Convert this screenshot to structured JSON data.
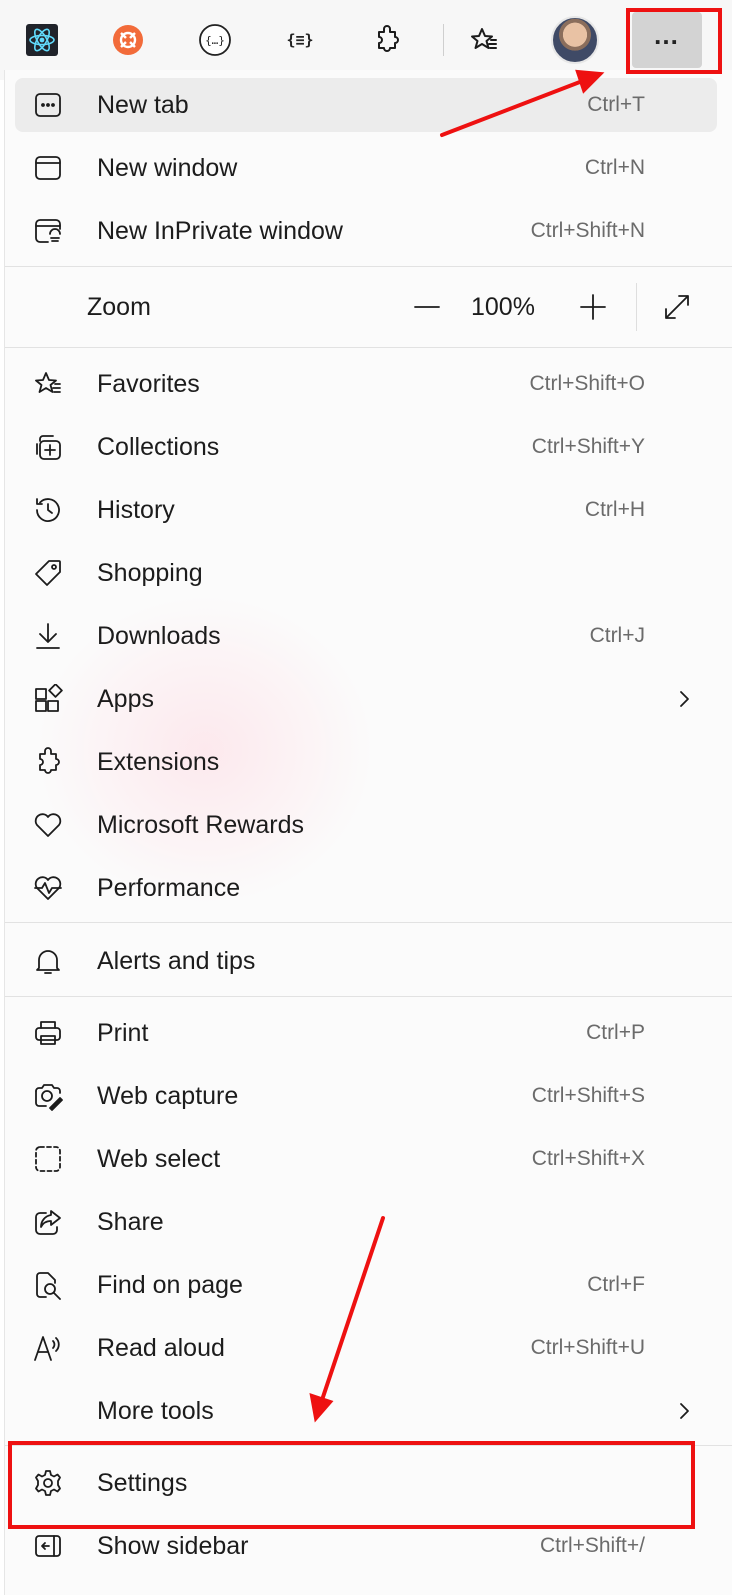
{
  "toolbar": {
    "icons": [
      "react-devtools-icon",
      "postman-icon",
      "json-viewer-icon",
      "json-formatter-icon",
      "extensions-icon",
      "favorites-icon",
      "profile-avatar",
      "more-icon"
    ]
  },
  "zoom": {
    "label": "Zoom",
    "value": "100%"
  },
  "menu": {
    "new_tab": {
      "label": "New tab",
      "shortcut": "Ctrl+T"
    },
    "new_window": {
      "label": "New window",
      "shortcut": "Ctrl+N"
    },
    "new_inprivate": {
      "label": "New InPrivate window",
      "shortcut": "Ctrl+Shift+N"
    },
    "favorites": {
      "label": "Favorites",
      "shortcut": "Ctrl+Shift+O"
    },
    "collections": {
      "label": "Collections",
      "shortcut": "Ctrl+Shift+Y"
    },
    "history": {
      "label": "History",
      "shortcut": "Ctrl+H"
    },
    "shopping": {
      "label": "Shopping"
    },
    "downloads": {
      "label": "Downloads",
      "shortcut": "Ctrl+J"
    },
    "apps": {
      "label": "Apps"
    },
    "extensions": {
      "label": "Extensions"
    },
    "rewards": {
      "label": "Microsoft Rewards"
    },
    "performance": {
      "label": "Performance"
    },
    "alerts": {
      "label": "Alerts and tips"
    },
    "print": {
      "label": "Print",
      "shortcut": "Ctrl+P"
    },
    "web_capture": {
      "label": "Web capture",
      "shortcut": "Ctrl+Shift+S"
    },
    "web_select": {
      "label": "Web select",
      "shortcut": "Ctrl+Shift+X"
    },
    "share": {
      "label": "Share"
    },
    "find": {
      "label": "Find on page",
      "shortcut": "Ctrl+F"
    },
    "read_aloud": {
      "label": "Read aloud",
      "shortcut": "Ctrl+Shift+U"
    },
    "more_tools": {
      "label": "More tools"
    },
    "settings": {
      "label": "Settings"
    },
    "show_sidebar": {
      "label": "Show sidebar",
      "shortcut": "Ctrl+Shift+/"
    }
  },
  "annotation_color": "#ee1111"
}
